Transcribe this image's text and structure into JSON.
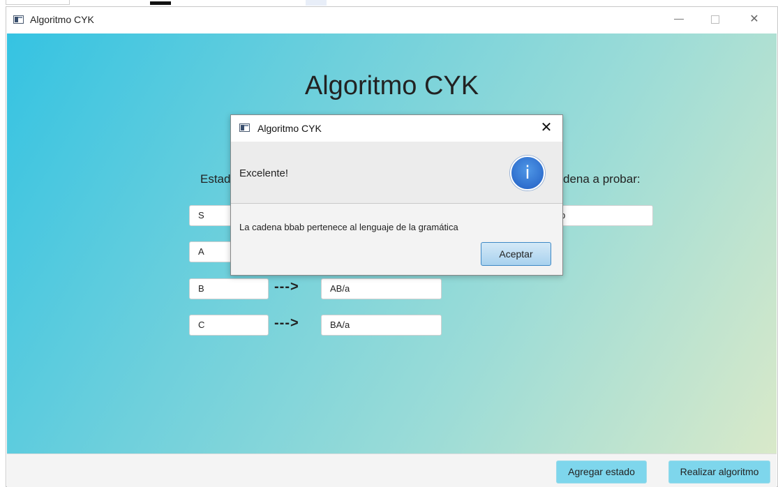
{
  "window": {
    "title": "Algoritmo CYK",
    "controls": {
      "minimize": "minimize-icon",
      "maximize": "maximize-icon",
      "close": "✕"
    }
  },
  "main": {
    "heading": "Algoritmo CYK",
    "estados_label": "Estad",
    "cadena_label": "dena a probar:",
    "cadena_value": "b",
    "rules": [
      {
        "state": "S",
        "arrow": "--->",
        "production": ""
      },
      {
        "state": "A",
        "arrow": "--->",
        "production": ""
      },
      {
        "state": "B",
        "arrow": "--->",
        "production": "AB/a"
      },
      {
        "state": "C",
        "arrow": "--->",
        "production": "BA/a"
      }
    ]
  },
  "footer": {
    "add_state": "Agregar estado",
    "run_algorithm": "Realizar algoritmo"
  },
  "dialog": {
    "title": "Algoritmo CYK",
    "close": "✕",
    "header": "Excelente!",
    "icon": "i",
    "message": "La cadena bbab pertenece al lenguaje de la gramática",
    "ok": "Aceptar"
  }
}
